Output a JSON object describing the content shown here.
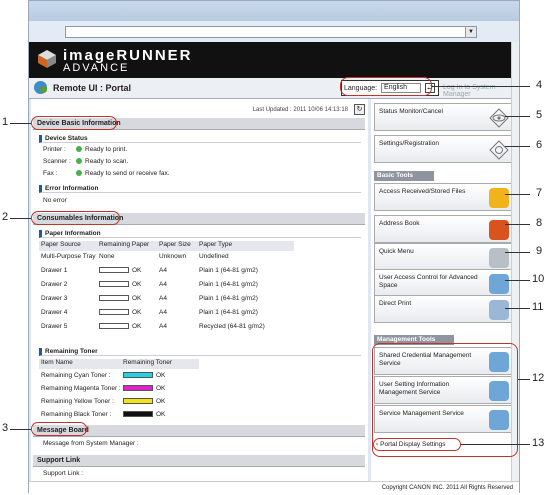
{
  "header": {
    "brand_line1": "imageRUNNER",
    "brand_line2": "ADVANCE",
    "title": "Remote UI : Portal",
    "language_label": "Language:",
    "language_value": "English",
    "logout": "Log In to System Manager"
  },
  "last_updated": "Last Updated : 2011 10/06 14:13:18",
  "device_basic": {
    "title": "Device Basic Information",
    "status_title": "Device Status",
    "rows": [
      {
        "label": "Printer :",
        "value": "Ready to print."
      },
      {
        "label": "Scanner :",
        "value": "Ready to scan."
      },
      {
        "label": "Fax :",
        "value": "Ready to send or receive fax."
      }
    ],
    "error_title": "Error Information",
    "error_value": "No error"
  },
  "consumables": {
    "title": "Consumables Information",
    "paper_title": "Paper Information",
    "headers": [
      "Paper Source",
      "Remaining Paper",
      "Paper Size",
      "Paper Type"
    ],
    "rows": [
      {
        "src": "Multi-Purpose Tray",
        "rem": "None",
        "size": "Unknown",
        "type": "Undefined"
      },
      {
        "src": "Drawer 1",
        "rem": "OK",
        "size": "A4",
        "type": "Plain 1 (64-81 g/m2)"
      },
      {
        "src": "Drawer 2",
        "rem": "OK",
        "size": "A4",
        "type": "Plain 1 (64-81 g/m2)"
      },
      {
        "src": "Drawer 3",
        "rem": "OK",
        "size": "A4",
        "type": "Plain 1 (64-81 g/m2)"
      },
      {
        "src": "Drawer 4",
        "rem": "OK",
        "size": "A4",
        "type": "Plain 1 (64-81 g/m2)"
      },
      {
        "src": "Drawer 5",
        "rem": "OK",
        "size": "A4",
        "type": "Recycled (64-81 g/m2)"
      }
    ],
    "toner_title": "Remaining Toner",
    "toner_headers": [
      "Item Name",
      "Remaining Toner"
    ],
    "toners": [
      {
        "name": "Remaining Cyan Toner :",
        "value": "OK",
        "color": "#22d3e6"
      },
      {
        "name": "Remaining Magenta Toner :",
        "value": "OK",
        "color": "#e020c8"
      },
      {
        "name": "Remaining Yellow Toner :",
        "value": "OK",
        "color": "#f2e21a"
      },
      {
        "name": "Remaining Black Toner :",
        "value": "OK",
        "color": "#111111"
      }
    ]
  },
  "message_board": {
    "title": "Message Board",
    "text": "Message from System Manager :"
  },
  "support": {
    "title": "Support Link",
    "text": "Support Link :"
  },
  "side": {
    "status_monitor": "Status Monitor/Cancel",
    "settings": "Settings/Registration",
    "basic_tools": "Basic Tools",
    "access_files": "Access Received/Stored Files",
    "address_book": "Address Book",
    "quick_menu": "Quick Menu",
    "user_access": "User Access Control for Advanced Space",
    "direct_print": "Direct Print",
    "management_tools": "Management Tools",
    "shared_cred": "Shared Credential Management Service",
    "user_setting": "User Setting Information Management Service",
    "service_mgmt": "Service Management Service",
    "portal_display": "Portal Display Settings"
  },
  "footer": "Copyright CANON INC. 2011 All Rights Reserved",
  "callouts": [
    "1",
    "2",
    "3",
    "4",
    "5",
    "6",
    "7",
    "8",
    "9",
    "10",
    "11",
    "12",
    "13"
  ]
}
